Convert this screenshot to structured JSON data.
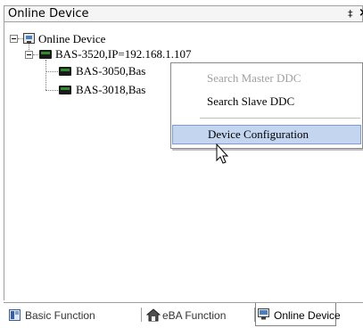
{
  "panel": {
    "title": "Online Device",
    "pin_glyph": "‡",
    "close_glyph": "×"
  },
  "tree": {
    "root": {
      "label": "Online Device",
      "icon": "device-icon"
    },
    "controller": {
      "label": "BAS-3520,IP=192.168.1.107",
      "icon": "ddc-icon"
    },
    "children": [
      {
        "label": "BAS-3050,Bas",
        "icon": "ddc-icon"
      },
      {
        "label": "BAS-3018,Bas",
        "icon": "ddc-icon"
      }
    ]
  },
  "context_menu": {
    "items": [
      {
        "label": "Search Master DDC",
        "enabled": false
      },
      {
        "label": "Search Slave DDC",
        "enabled": true
      },
      {
        "label": "Device Configuration",
        "enabled": true,
        "highlighted": true
      }
    ]
  },
  "tabs": [
    {
      "label": "Basic Function",
      "icon": "basic-function-icon",
      "active": false
    },
    {
      "label": "eBA Function",
      "icon": "building-icon",
      "active": false
    },
    {
      "label": "Online Device",
      "icon": "device-icon",
      "active": true
    }
  ],
  "colors": {
    "menu_highlight": "#c4d5f0",
    "disabled_text": "#a0a0a0",
    "ddc_led": "#2e8b2e"
  }
}
